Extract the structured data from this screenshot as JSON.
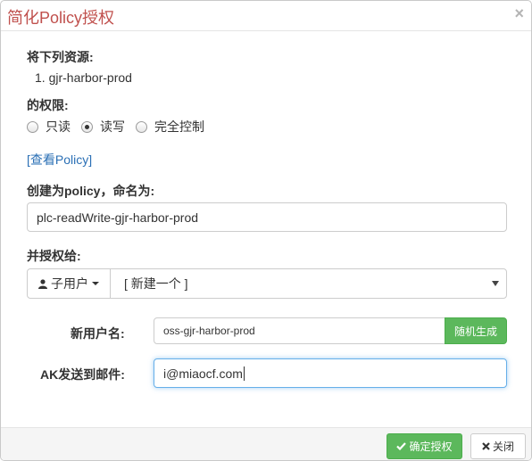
{
  "header": {
    "title": "简化Policy授权",
    "close_glyph": "×"
  },
  "resources": {
    "label": "将下列资源:",
    "items": [
      "1.  gjr-harbor-prod"
    ]
  },
  "permissions": {
    "label": "的权限:",
    "options": [
      "只读",
      "读写",
      "完全控制"
    ],
    "selected": "读写"
  },
  "view_policy_link": "[查看Policy]",
  "policy_name": {
    "label": "创建为policy，命名为:",
    "value": "plc-readWrite-gjr-harbor-prod"
  },
  "grant_to": {
    "label": "并授权给:",
    "type_button": "子用户",
    "user_icon": "user-icon",
    "select_value": "[ 新建一个 ]"
  },
  "new_user": {
    "label": "新用户名:",
    "value": "oss-gjr-harbor-prod",
    "random_button": "随机生成"
  },
  "ak_email": {
    "label": "AK发送到邮件:",
    "value": "i@miaocf.com"
  },
  "footer": {
    "confirm_label": "确定授权",
    "confirm_icon": "check-icon",
    "close_label": "关闭",
    "close_icon": "times-icon"
  },
  "colors": {
    "title": "#c0504d",
    "primary": "#5cb85c",
    "link": "#2a6fb5",
    "focus": "#66afe9"
  }
}
